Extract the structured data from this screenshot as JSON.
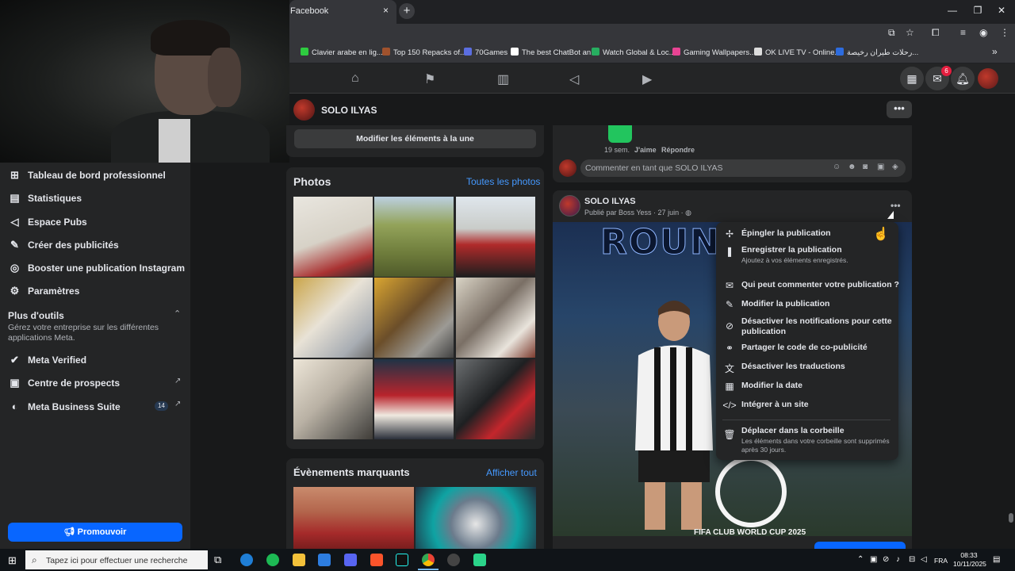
{
  "browser": {
    "tab_title": "Facebook",
    "tab_close": "×",
    "new_tab": "+",
    "window": {
      "minimize": "—",
      "restore": "❐",
      "close": "✕"
    },
    "toolbar_icons": [
      "install-icon",
      "star-icon",
      "extensions-icon",
      "tab-search-icon",
      "profile-icon",
      "menu-icon"
    ],
    "bookmarks": [
      {
        "label": "Clavier arabe en lig...",
        "color": "#2ecc40"
      },
      {
        "label": "Top 150 Repacks of...",
        "color": "#a0522d"
      },
      {
        "label": "70Games",
        "color": "#5b6ee1"
      },
      {
        "label": "The best ChatBot an...",
        "color": "#ffffff"
      },
      {
        "label": "Watch Global & Loc...",
        "color": "#27ae60"
      },
      {
        "label": "Gaming Wallpapers...",
        "color": "#e84393"
      },
      {
        "label": "OK LIVE TV - Online...",
        "color": "#dddddd"
      },
      {
        "label": "رحلات طيران رخيصة...",
        "color": "#2d6cdf"
      }
    ],
    "bookmarks_more": "»"
  },
  "fb_nav": {
    "icons": [
      "home-icon",
      "flag-icon",
      "insights-icon",
      "megaphone-icon",
      "video-icon"
    ],
    "messenger_badge": "6"
  },
  "page": {
    "name": "SOLO ILYAS",
    "more": "•••"
  },
  "sidebar": {
    "items": [
      {
        "label": "Tableau de bord professionnel",
        "icon": "dashboard-icon"
      },
      {
        "label": "Statistiques",
        "icon": "stats-icon"
      },
      {
        "label": "Espace Pubs",
        "icon": "ads-icon"
      },
      {
        "label": "Créer des publicités",
        "icon": "edit-icon"
      },
      {
        "label": "Booster une publication Instagram",
        "icon": "instagram-icon"
      },
      {
        "label": "Paramètres",
        "icon": "gear-icon"
      }
    ],
    "tools_title": "Plus d'outils",
    "tools_desc": "Gérez votre entreprise sur les différentes applications Meta.",
    "tools_items": [
      {
        "label": "Meta Verified",
        "icon": "verified-icon"
      },
      {
        "label": "Centre de prospects",
        "icon": "leads-icon"
      },
      {
        "label": "Meta Business Suite",
        "icon": "business-suite-icon",
        "badge": "14"
      }
    ],
    "promote_label": "Promouvoir"
  },
  "middle": {
    "feature_button": "Modifier les éléments à la une",
    "photos_title": "Photos",
    "photos_all": "Toutes les photos",
    "events_title": "Évènements marquants",
    "events_all": "Afficher tout"
  },
  "post1": {
    "time": "19 sem.",
    "like": "J'aime",
    "reply": "Répondre",
    "comment_placeholder": "Commenter en tant que SOLO ILYAS"
  },
  "post2": {
    "author": "SOLO ILYAS",
    "meta": "Publié par Boss Yess · 27 juin ·",
    "image_headline": "ROUN",
    "image_event": "FIFA CLUB WORLD CUP 2025"
  },
  "menu": {
    "items": [
      {
        "label": "Épingler la publication",
        "icon": "pin-icon"
      },
      {
        "label": "Enregistrer la publication",
        "icon": "bookmark-icon",
        "sub": "Ajoutez à vos éléments enregistrés."
      },
      {
        "label": "Qui peut commenter votre publication ?",
        "icon": "comment-icon"
      },
      {
        "label": "Modifier la publication",
        "icon": "pencil-icon"
      },
      {
        "label": "Désactiver les notifications pour cette publication",
        "icon": "bell-off-icon"
      },
      {
        "label": "Partager le code de co-publicité",
        "icon": "handshake-icon"
      },
      {
        "label": "Désactiver les traductions",
        "icon": "translate-icon"
      },
      {
        "label": "Modifier la date",
        "icon": "calendar-icon"
      },
      {
        "label": "Intégrer à un site",
        "icon": "code-icon"
      },
      {
        "label": "Déplacer dans la corbeille",
        "icon": "trash-icon",
        "sub": "Les éléments dans votre corbeille sont supprimés après 30 jours."
      }
    ]
  },
  "taskbar": {
    "search_placeholder": "Tapez ici pour effectuer une recherche",
    "language": "FRA",
    "time": "08:33",
    "date": "10/11/2025"
  }
}
